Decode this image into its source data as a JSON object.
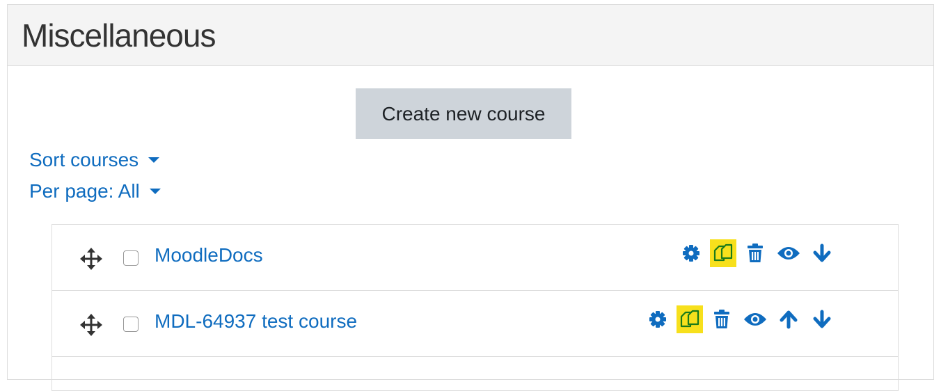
{
  "category": {
    "title": "Miscellaneous"
  },
  "toolbar": {
    "create_label": "Create new course",
    "sort_label": "Sort courses",
    "perpage_label": "Per page: All"
  },
  "courses": [
    {
      "name": "MoodleDocs",
      "actions": [
        "settings-icon",
        "copy-icon",
        "delete-icon",
        "visibility-icon",
        "move-down-icon"
      ]
    },
    {
      "name": "MDL-64937 test course",
      "actions": [
        "settings-icon",
        "copy-icon",
        "delete-icon",
        "visibility-icon",
        "move-up-icon",
        "move-down-icon"
      ]
    }
  ],
  "colors": {
    "link": "#0f6cbf",
    "highlight": "#f7e01c",
    "highlight_icon": "#1a7a1a",
    "button_bg": "#ced4da"
  }
}
